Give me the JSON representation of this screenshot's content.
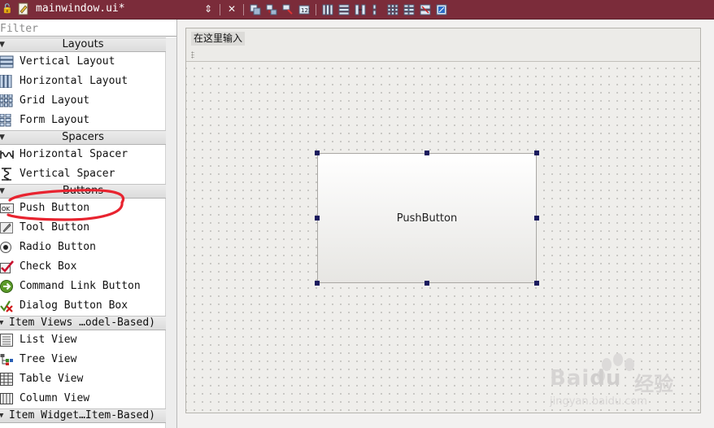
{
  "titlebar": {
    "filename": "mainwindow.ui*",
    "lock_glyph": "🔓",
    "arrows_glyph": "⇕",
    "close_glyph": "✕"
  },
  "toolbar_icons": [
    "edit-widgets-icon",
    "edit-signals-icon",
    "edit-buddies-icon",
    "edit-tab-order-icon",
    "layout-horizontal-icon",
    "layout-vertical-icon",
    "layout-horizontal-splitter-icon",
    "layout-vertical-splitter-icon",
    "layout-grid-icon",
    "layout-form-icon",
    "break-layout-icon",
    "adjust-size-icon"
  ],
  "widgetbox": {
    "filter_placeholder": "Filter",
    "categories": {
      "layouts": "Layouts",
      "spacers": "Spacers",
      "buttons": "Buttons",
      "item_views": "Item Views …odel-Based)",
      "item_widgets": "Item Widget…Item-Based)"
    },
    "items": {
      "vertical_layout": "Vertical Layout",
      "horizontal_layout": "Horizontal Layout",
      "grid_layout": "Grid Layout",
      "form_layout": "Form Layout",
      "horizontal_spacer": "Horizontal Spacer",
      "vertical_spacer": "Vertical Spacer",
      "push_button": "Push Button",
      "tool_button": "Tool Button",
      "radio_button": "Radio Button",
      "check_box": "Check Box",
      "command_link_button": "Command Link Button",
      "dialog_button_box": "Dialog Button Box",
      "list_view": "List View",
      "tree_view": "Tree View",
      "table_view": "Table View",
      "column_view": "Column View"
    },
    "ok_icon_text": "OK"
  },
  "form": {
    "menu_placeholder": "在这里输入",
    "push_button_label": "PushButton"
  },
  "watermark": {
    "brand": "Bai",
    "brand2": "du",
    "cn": "经验",
    "url": "jingyan.baidu.com"
  },
  "colors": {
    "titlebar": "#7b2c3a",
    "annotation": "#e8232f",
    "handle": "#1a1a5e"
  }
}
